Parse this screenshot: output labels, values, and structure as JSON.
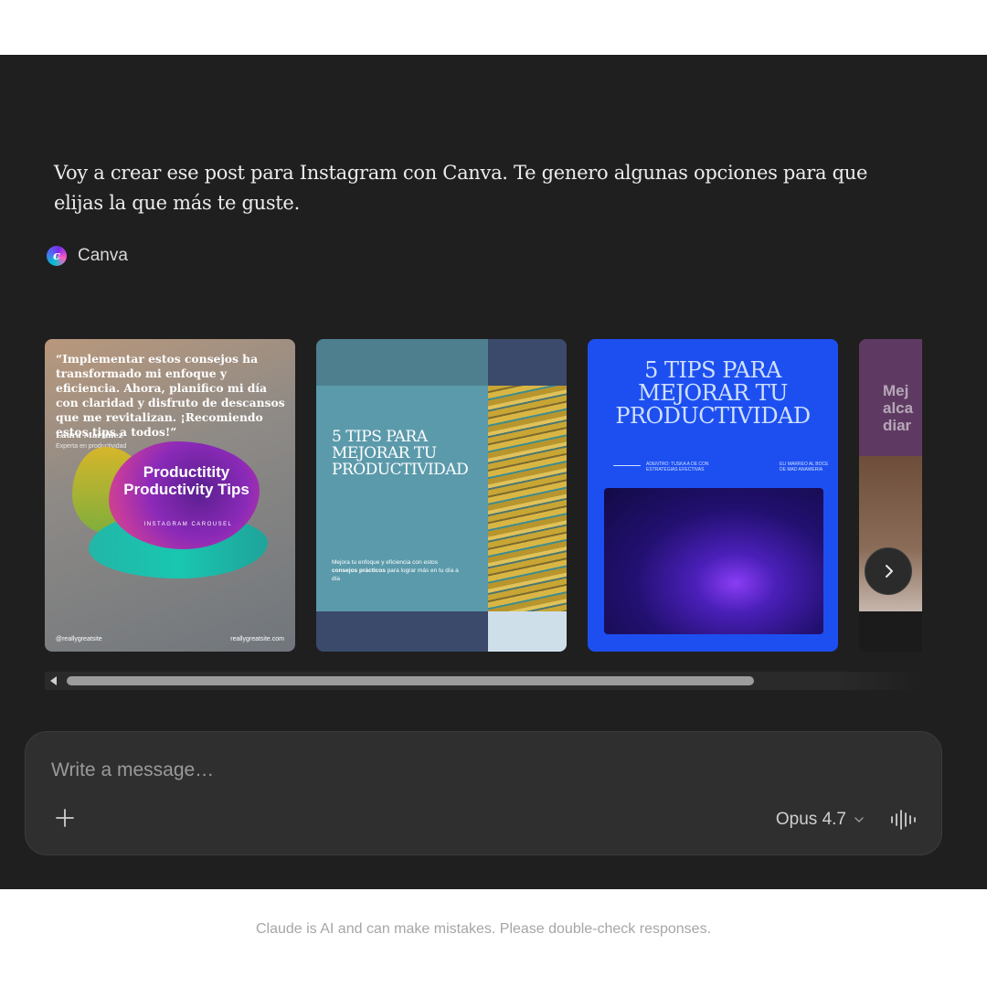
{
  "message": {
    "text": "Voy a crear ese post para Instagram con Canva. Te genero algunas opciones para que elijas la que más te guste."
  },
  "tool": {
    "name": "Canva",
    "icon": "canva-logo-icon"
  },
  "cards": [
    {
      "quote": "“Implementar estos consejos ha transformado mi enfoque y eficiencia. Ahora, planifico mi día con claridad y disfruto de descansos que me revitalizan. ¡Recomiendo estos tips a todos!”",
      "author": "Laura Martínez",
      "role": "Experta en productividad",
      "title": "Productitity Productivity Tips",
      "subtitle": "INSTAGRAM CAROUSEL",
      "handle": "@reallygreatsite",
      "site": "reallygreatsite.com"
    },
    {
      "title": "5 TIPS PARA MEJORAR TU PRODUCTIVIDAD",
      "subtitle_pre": "Mejora tu enfoque y eficiencia con estos ",
      "subtitle_bold": "consejos prácticos",
      "subtitle_post": " para lograr más en tu día a día"
    },
    {
      "title": "5 TIPS PARA MEJORAR TU PRODUCTIVIDAD",
      "small_left": "ADENTRO: TUSKA A DE CON ESTRATEGIAS EFECTIVAS",
      "small_right": "ELI MARREO AL BOCE DE MAD ANAWERIA"
    },
    {
      "title": "Mej alca diar"
    }
  ],
  "composer": {
    "placeholder": "Write a message…",
    "model_label": "Opus 4.7"
  },
  "disclaimer": "Claude is AI and can make mistakes. Please double-check responses."
}
